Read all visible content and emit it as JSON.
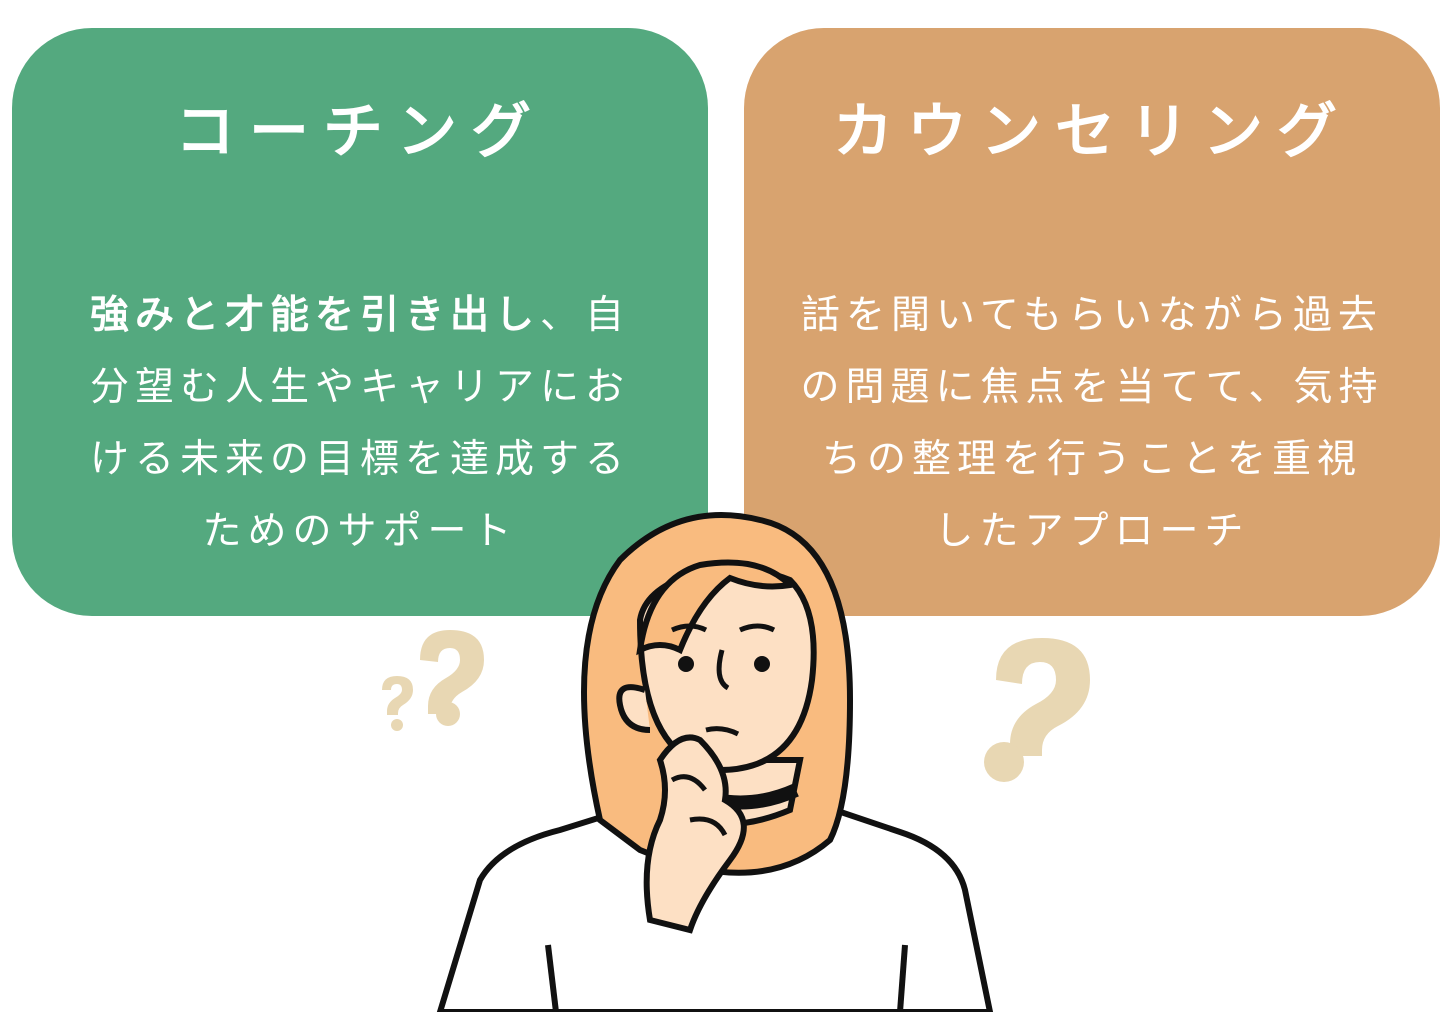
{
  "coaching": {
    "title": "コーチング",
    "body_strong": "強みと才能を引き出し",
    "body_rest": "、自分望む人生やキャリアにおける未来の目標を達成するためのサポート",
    "color": "#54a97f"
  },
  "counseling": {
    "title": "カウンセリング",
    "body": "話を聞いてもらいながら過去の問題に焦点を当てて、気持ちの整理を行うことを重視したアプローチ",
    "color": "#d8a36f"
  },
  "illustration": {
    "icons": [
      "question-mark-icon",
      "question-mark-icon",
      "question-mark-icon"
    ],
    "question_color": "#e8d7b3",
    "hair_color": "#f9bb7f",
    "skin_color": "#fde0c4"
  }
}
